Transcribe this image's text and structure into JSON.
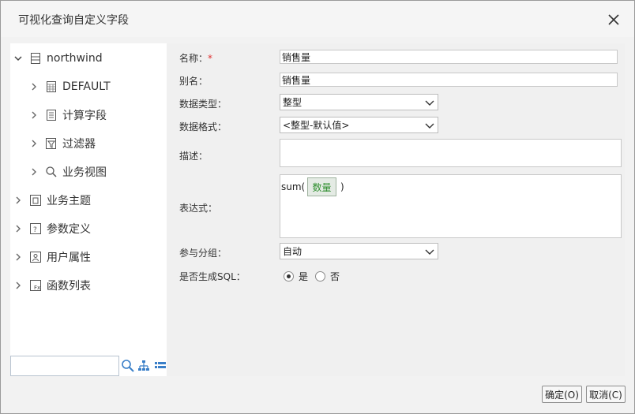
{
  "dialog": {
    "title": "可视化查询自定义字段"
  },
  "tree": {
    "root": "northwind",
    "children": [
      "DEFAULT",
      "计算字段",
      "过滤器",
      "业务视图"
    ],
    "top_items": [
      "业务主题",
      "参数定义",
      "用户属性",
      "函数列表"
    ]
  },
  "search": {
    "value": ""
  },
  "form": {
    "name_label": "名称：",
    "name_required": "*",
    "name_value": "销售量",
    "alias_label": "别名：",
    "alias_value": "销售量",
    "type_label": "数据类型：",
    "type_value": "整型",
    "format_label": "数据格式：",
    "format_value": "<整型-默认值>",
    "desc_label": "描述：",
    "desc_value": "",
    "expr_label": "表达式：",
    "expr_func": "sum(",
    "expr_field": "数量",
    "expr_close": ")",
    "group_label": "参与分组：",
    "group_value": "自动",
    "sql_label": "是否生成SQL：",
    "sql_yes": "是",
    "sql_no": "否",
    "sql_selected": "是"
  },
  "buttons": {
    "ok": "确定(O)",
    "cancel": "取消(C)"
  },
  "icons": [
    "close-icon",
    "database-icon",
    "table-icon",
    "calc-field-icon",
    "filter-icon",
    "search-icon",
    "topic-icon",
    "param-icon",
    "user-attr-icon",
    "function-icon",
    "tree-view-icon",
    "list-view-icon",
    "chevron-down-icon",
    "chevron-right-icon"
  ]
}
